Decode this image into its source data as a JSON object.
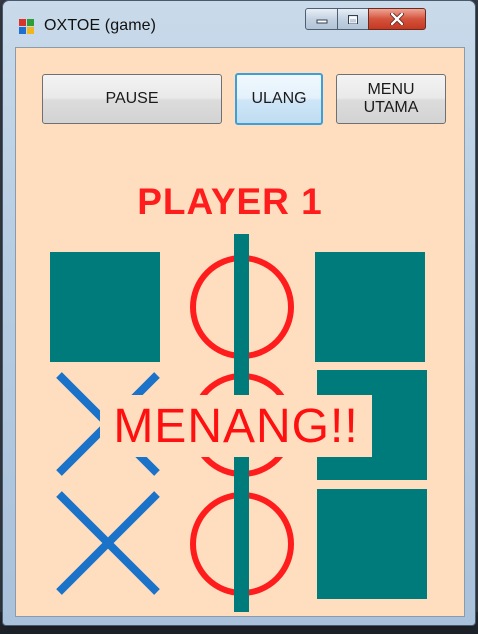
{
  "window": {
    "title": "OXTOE (game)",
    "icons": [
      "app-icon",
      "minimize-icon",
      "maximize-icon",
      "close-icon"
    ]
  },
  "toolbar": {
    "pause_label": "PAUSE",
    "ulang_label": "ULANG",
    "menu_label": "MENU\nUTAMA"
  },
  "status": {
    "player_label": "PLAYER 1",
    "win_label": "MENANG!!"
  },
  "board": {
    "cells": [
      [
        "square",
        "O",
        "square"
      ],
      [
        "X",
        "O",
        "square"
      ],
      [
        "X",
        "O",
        "square"
      ]
    ],
    "winning_column": 2
  },
  "colors": {
    "background": "#ffdec0",
    "square": "#007b7b",
    "o_mark": "#ff1c1c",
    "x_mark": "#1a73c8",
    "text_accent": "#ff1c1c"
  }
}
